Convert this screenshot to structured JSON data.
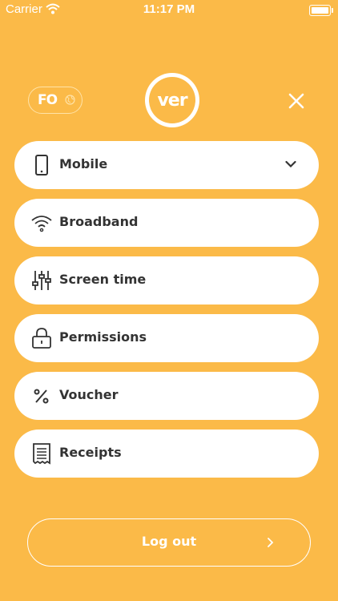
{
  "status_bar": {
    "carrier": "Carrier",
    "time": "11:17 PM"
  },
  "header": {
    "language_code": "FO",
    "logo_text": "ver"
  },
  "menu": {
    "items": [
      {
        "label": "Mobile",
        "icon": "phone-icon"
      },
      {
        "label": "Broadband",
        "icon": "wifi-icon"
      },
      {
        "label": "Screen time",
        "icon": "sliders-icon"
      },
      {
        "label": "Permissions",
        "icon": "lock-icon"
      },
      {
        "label": "Voucher",
        "icon": "percent-icon"
      },
      {
        "label": "Receipts",
        "icon": "receipt-icon"
      }
    ]
  },
  "footer": {
    "logout_label": "Log out"
  },
  "colors": {
    "background": "#FBBA48",
    "card": "#FFFFFF",
    "text": "#333333"
  }
}
